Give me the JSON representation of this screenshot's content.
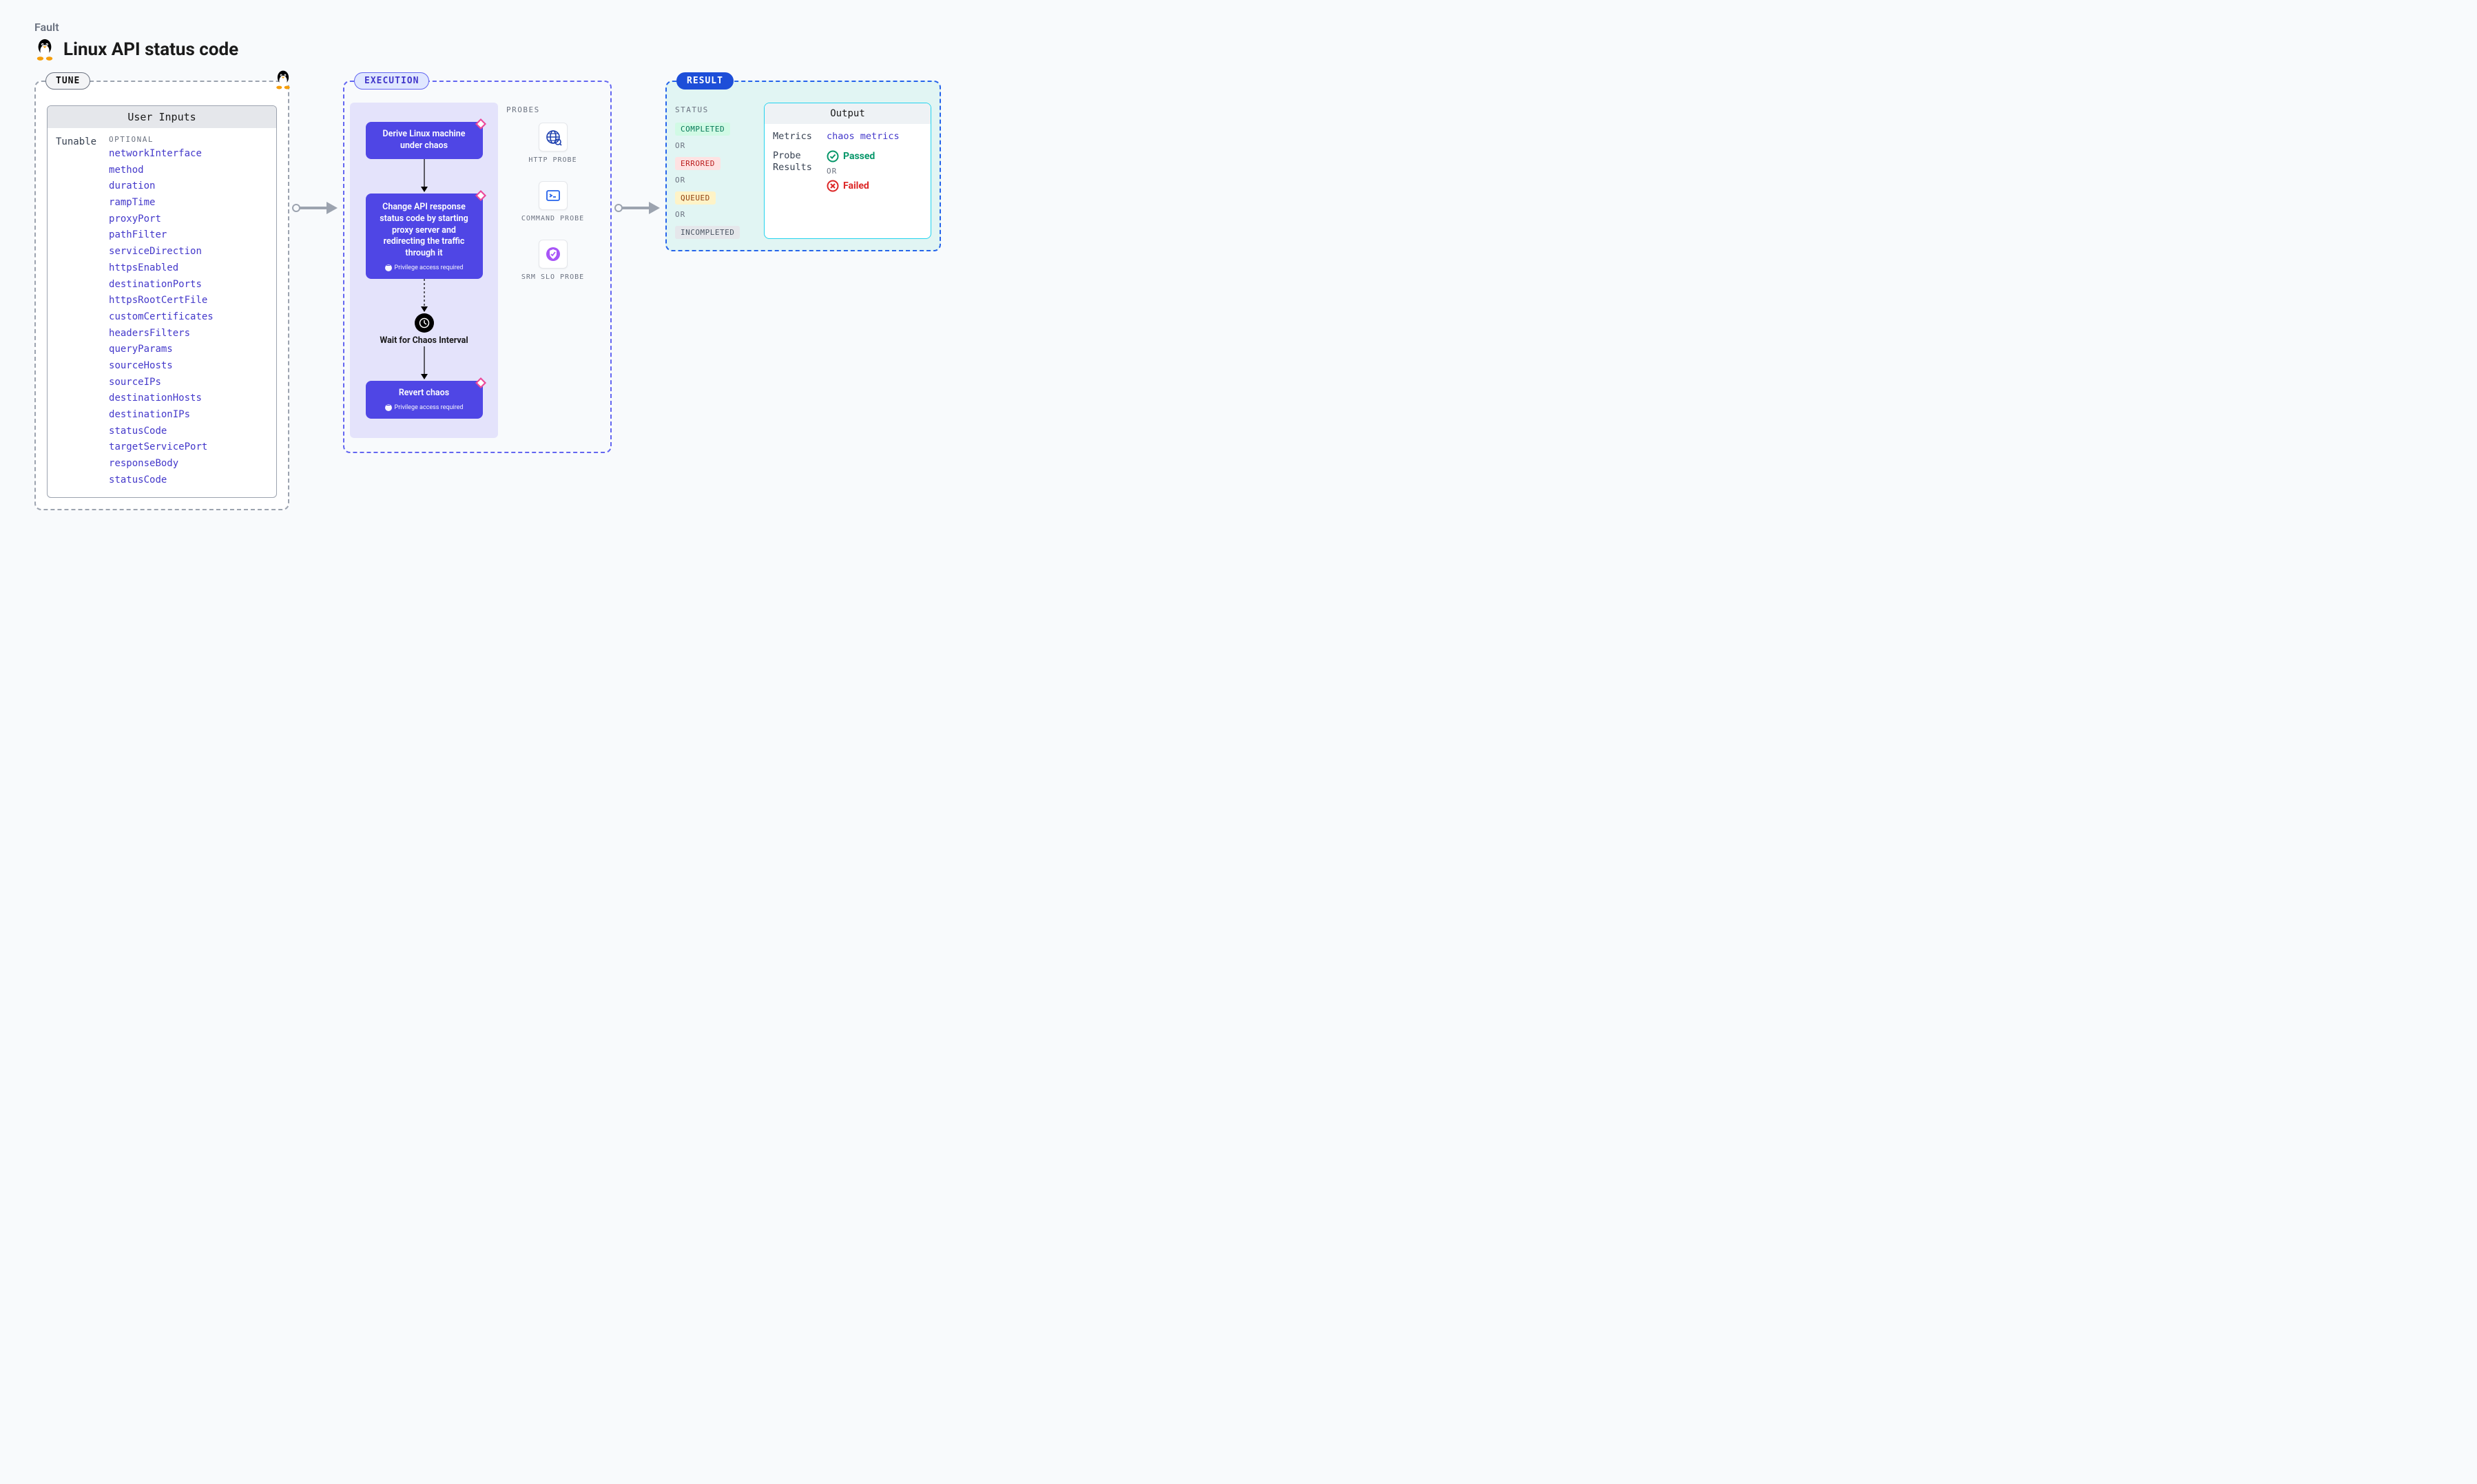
{
  "header": {
    "label": "Fault",
    "title": "Linux API status code"
  },
  "tune": {
    "label": "TUNE",
    "user_inputs_title": "User Inputs",
    "tunable_label": "Tunable",
    "optional_label": "OPTIONAL",
    "optional": [
      "networkInterface",
      "method",
      "duration",
      "rampTime",
      "proxyPort",
      "pathFilter",
      "serviceDirection",
      "httpsEnabled",
      "destinationPorts",
      "httpsRootCertFile",
      "customCertificates",
      "headersFilters",
      "queryParams",
      "sourceHosts",
      "sourceIPs",
      "destinationHosts",
      "destinationIPs",
      "statusCode",
      "targetServicePort",
      "responseBody",
      "statusCode"
    ]
  },
  "execution": {
    "label": "EXECUTION",
    "step1": "Derive Linux machine under chaos",
    "step2": "Change API response status code by starting proxy server and redirecting the traffic through it",
    "priv_note": "Privilege access required",
    "wait_label": "Wait for Chaos Interval",
    "step3": "Revert chaos",
    "probes_label": "PROBES",
    "probes": [
      {
        "name": "HTTP PROBE",
        "icon": "globe"
      },
      {
        "name": "COMMAND PROBE",
        "icon": "terminal"
      },
      {
        "name": "SRM SLO PROBE",
        "icon": "shield"
      }
    ]
  },
  "result": {
    "label": "RESULT",
    "status_label": "STATUS",
    "statuses": {
      "completed": "COMPLETED",
      "errored": "ERRORED",
      "queued": "QUEUED",
      "incompleted": "INCOMPLETED"
    },
    "or": "OR",
    "output_title": "Output",
    "metrics_label": "Metrics",
    "metrics_value": "chaos metrics",
    "probe_results_label": "Probe Results",
    "passed": "Passed",
    "failed": "Failed"
  }
}
